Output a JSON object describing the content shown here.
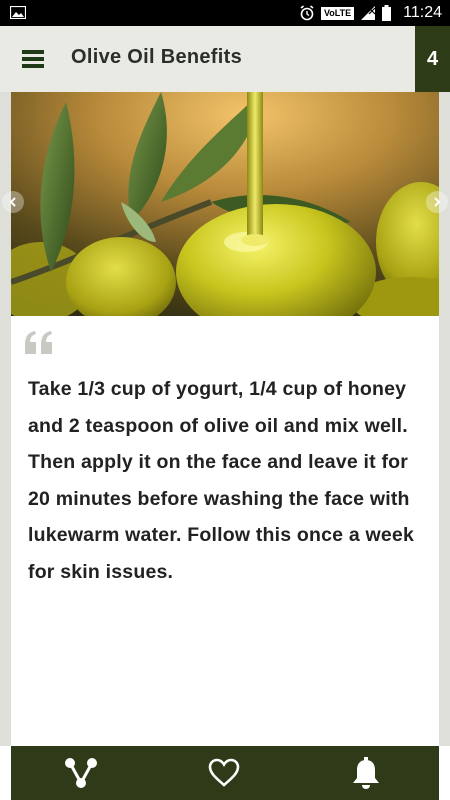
{
  "status_bar": {
    "time": "11:24",
    "volte_label": "VoLTE"
  },
  "app_bar": {
    "title": "Olive Oil Benefits",
    "page_number": "4"
  },
  "content": {
    "tip_text": "Take 1/3 cup of yogurt, 1/4 cup of honey and 2 teaspoon of olive oil and mix well. Then apply it on the face and leave it for 20 minutes before washing the face with lukewarm water. Follow this once a week for skin issues."
  },
  "bottom_nav": {
    "icons": [
      "share-icon",
      "heart-icon",
      "bell-icon"
    ]
  },
  "colors": {
    "app_bar_bg": "#e9eae4",
    "accent_dark_green": "#2f3a18",
    "text": "#222222"
  }
}
